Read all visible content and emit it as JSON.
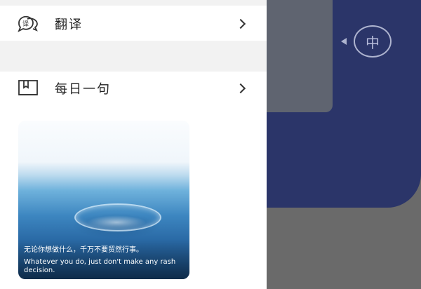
{
  "menu": {
    "translate_label": "翻译",
    "daily_label": "每日一句"
  },
  "language_toggle": {
    "label": "中"
  },
  "daily": {
    "quote_zh": "无论你想做什么，千万不要贸然行事。",
    "quote_en": "Whatever you do, just don't make any rash decision."
  },
  "colors": {
    "overlay": "#6a6a6a",
    "accent_blue": "#2b3569"
  },
  "icons": {
    "translate": "translate-bubble-icon",
    "daily": "book-icon"
  }
}
